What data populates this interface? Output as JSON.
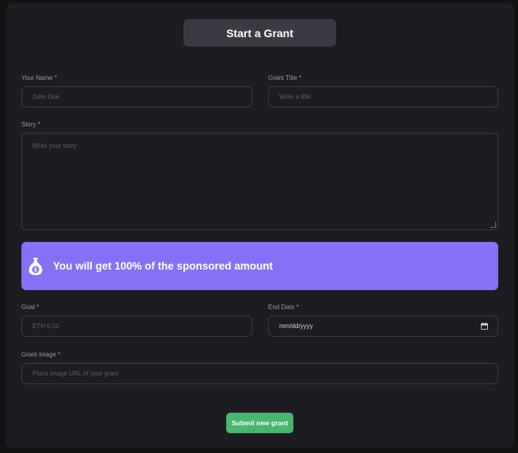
{
  "form": {
    "heading": "Start a Grant",
    "name": {
      "label": "Your Name *",
      "placeholder": "John Doe"
    },
    "grant_title": {
      "label": "Grant Title *",
      "placeholder": "Write a title"
    },
    "story": {
      "label": "Story *",
      "placeholder": "Write your story"
    },
    "banner": {
      "text": "You will get 100% of the sponsored amount",
      "icon": "money-bag-icon"
    },
    "goal": {
      "label": "Goal *",
      "placeholder": "ETH 0.50"
    },
    "end_date": {
      "label": "End Date *",
      "placeholder": "mm/dd/yyyy",
      "icon": "calendar-icon"
    },
    "grant_image": {
      "label": "Grant image *",
      "placeholder": "Place image URL of your grant"
    },
    "submit_label": "Submit new grant"
  },
  "colors": {
    "page_bg": "#131316",
    "card_bg": "#1c1c21",
    "heading_bg": "#3a3a43",
    "banner_bg": "#8471f5",
    "submit_bg": "#49b56d",
    "input_border": "#3a3a43"
  }
}
